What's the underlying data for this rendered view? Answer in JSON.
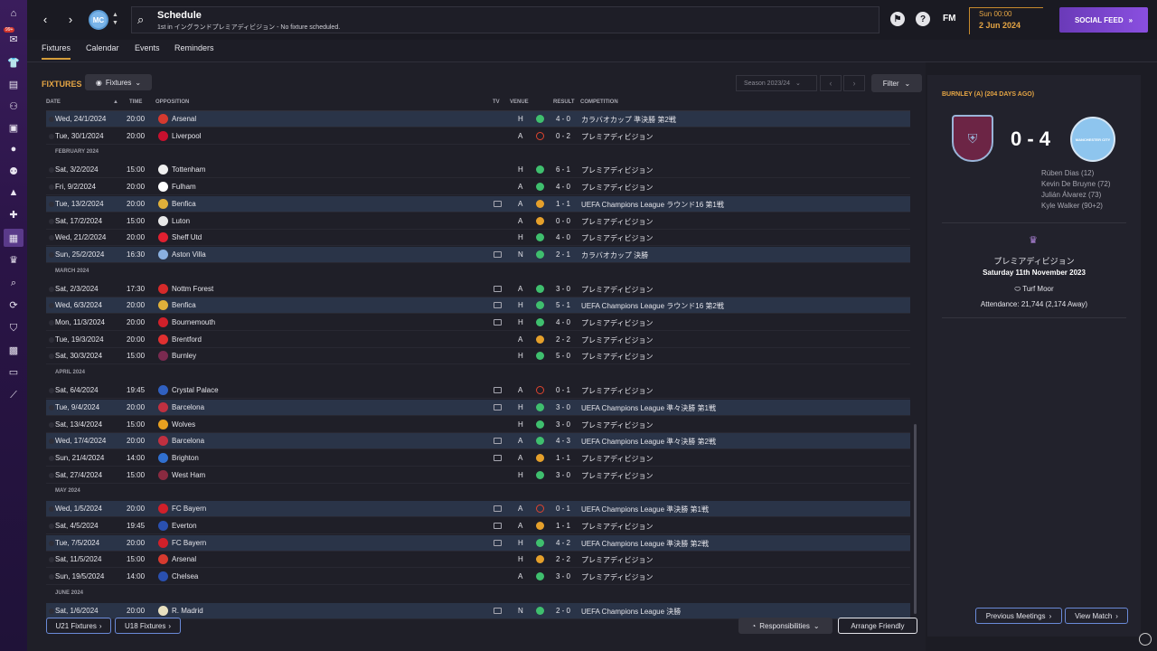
{
  "sidebar": {
    "badge": "99+",
    "icons": [
      "home-icon",
      "inbox-icon",
      "squad-icon",
      "tactics-icon",
      "staff-icon",
      "dynamics-icon",
      "medical-icon",
      "scouting-icon",
      "training-icon",
      "club-vision-icon",
      "schedule-icon",
      "competitions-icon",
      "data-hub-icon",
      "transfers-icon",
      "club-info-icon",
      "finances-icon",
      "dev-centre-icon",
      "report-icon"
    ]
  },
  "topbar": {
    "back": "‹",
    "forward": "›",
    "title": "Schedule",
    "subtitle": "1st in イングランドプレミアディビジョン - No fixture scheduled.",
    "help": "?",
    "fm": "FM",
    "time": "Sun 00:00",
    "date": "2 Jun 2024",
    "social_feed": "SOCIAL FEED"
  },
  "subtabs": [
    "Fixtures",
    "Calendar",
    "Events",
    "Reminders"
  ],
  "main": {
    "title": "FIXTURES",
    "dropdown": "Fixtures",
    "season": "Season 2023/24",
    "filter": "Filter",
    "headers": {
      "date": "DATE",
      "time": "TIME",
      "opposition": "OPPOSITION",
      "tv": "TV",
      "venue": "VENUE",
      "result": "RESULT",
      "competition": "COMPETITION"
    },
    "u21": "U21 Fixtures",
    "u18": "U18 Fixtures",
    "responsibilities": "Responsibilities",
    "arrange_friendly": "Arrange Friendly"
  },
  "fixtures": [
    {
      "date": "Wed, 24/1/2024",
      "time": "20:00",
      "opp": "Arsenal",
      "tv": false,
      "venue": "H",
      "outcome": "W",
      "score": "4 - 0",
      "comp": "カラバオカップ 準決勝 第2戦",
      "hl": true,
      "crest": "#d63a2f"
    },
    {
      "date": "Tue, 30/1/2024",
      "time": "20:00",
      "opp": "Liverpool",
      "tv": false,
      "venue": "A",
      "outcome": "L",
      "score": "0 - 2",
      "comp": "プレミアディビジョン",
      "hl": false,
      "crest": "#c8102e"
    },
    {
      "month": "FEBRUARY 2024"
    },
    {
      "date": "Sat, 3/2/2024",
      "time": "15:00",
      "opp": "Tottenham",
      "tv": false,
      "venue": "H",
      "outcome": "W",
      "score": "6 - 1",
      "comp": "プレミアディビジョン",
      "hl": false,
      "crest": "#f0f0f0"
    },
    {
      "date": "Fri, 9/2/2024",
      "time": "20:00",
      "opp": "Fulham",
      "tv": false,
      "venue": "A",
      "outcome": "W",
      "score": "4 - 0",
      "comp": "プレミアディビジョン",
      "hl": false,
      "crest": "#ffffff"
    },
    {
      "date": "Tue, 13/2/2024",
      "time": "20:00",
      "opp": "Benfica",
      "tv": true,
      "venue": "A",
      "outcome": "D",
      "score": "1 - 1",
      "comp": "UEFA Champions League ラウンド16 第1戦",
      "hl": true,
      "crest": "#e0b03a"
    },
    {
      "date": "Sat, 17/2/2024",
      "time": "15:00",
      "opp": "Luton",
      "tv": false,
      "venue": "A",
      "outcome": "D",
      "score": "0 - 0",
      "comp": "プレミアディビジョン",
      "hl": false,
      "crest": "#e8e8e8"
    },
    {
      "date": "Wed, 21/2/2024",
      "time": "20:00",
      "opp": "Sheff Utd",
      "tv": false,
      "venue": "H",
      "outcome": "W",
      "score": "4 - 0",
      "comp": "プレミアディビジョン",
      "hl": false,
      "crest": "#e02030"
    },
    {
      "date": "Sun, 25/2/2024",
      "time": "16:30",
      "opp": "Aston Villa",
      "tv": true,
      "venue": "N",
      "outcome": "W",
      "score": "2 - 1",
      "comp": "カラバオカップ 決勝",
      "hl": true,
      "crest": "#8ab0e0"
    },
    {
      "month": "MARCH 2024"
    },
    {
      "date": "Sat, 2/3/2024",
      "time": "17:30",
      "opp": "Nottm Forest",
      "tv": true,
      "venue": "A",
      "outcome": "W",
      "score": "3 - 0",
      "comp": "プレミアディビジョン",
      "hl": false,
      "crest": "#d62a2a"
    },
    {
      "date": "Wed, 6/3/2024",
      "time": "20:00",
      "opp": "Benfica",
      "tv": true,
      "venue": "H",
      "outcome": "W",
      "score": "5 - 1",
      "comp": "UEFA Champions League ラウンド16 第2戦",
      "hl": true,
      "crest": "#e0b03a"
    },
    {
      "date": "Mon, 11/3/2024",
      "time": "20:00",
      "opp": "Bournemouth",
      "tv": true,
      "venue": "H",
      "outcome": "W",
      "score": "4 - 0",
      "comp": "プレミアディビジョン",
      "hl": false,
      "crest": "#d0202a"
    },
    {
      "date": "Tue, 19/3/2024",
      "time": "20:00",
      "opp": "Brentford",
      "tv": false,
      "venue": "A",
      "outcome": "D",
      "score": "2 - 2",
      "comp": "プレミアディビジョン",
      "hl": false,
      "crest": "#e03030"
    },
    {
      "date": "Sat, 30/3/2024",
      "time": "15:00",
      "opp": "Burnley",
      "tv": false,
      "venue": "H",
      "outcome": "W",
      "score": "5 - 0",
      "comp": "プレミアディビジョン",
      "hl": false,
      "crest": "#7a2a50"
    },
    {
      "month": "APRIL 2024"
    },
    {
      "date": "Sat, 6/4/2024",
      "time": "19:45",
      "opp": "Crystal Palace",
      "tv": true,
      "venue": "A",
      "outcome": "L",
      "score": "0 - 1",
      "comp": "プレミアディビジョン",
      "hl": false,
      "crest": "#3060c0"
    },
    {
      "date": "Tue, 9/4/2024",
      "time": "20:00",
      "opp": "Barcelona",
      "tv": true,
      "venue": "H",
      "outcome": "W",
      "score": "3 - 0",
      "comp": "UEFA Champions League 準々決勝 第1戦",
      "hl": true,
      "crest": "#c03040"
    },
    {
      "date": "Sat, 13/4/2024",
      "time": "15:00",
      "opp": "Wolves",
      "tv": false,
      "venue": "H",
      "outcome": "W",
      "score": "3 - 0",
      "comp": "プレミアディビジョン",
      "hl": false,
      "crest": "#e8a020"
    },
    {
      "date": "Wed, 17/4/2024",
      "time": "20:00",
      "opp": "Barcelona",
      "tv": true,
      "venue": "A",
      "outcome": "W",
      "score": "4 - 3",
      "comp": "UEFA Champions League 準々決勝 第2戦",
      "hl": true,
      "crest": "#c03040"
    },
    {
      "date": "Sun, 21/4/2024",
      "time": "14:00",
      "opp": "Brighton",
      "tv": true,
      "venue": "A",
      "outcome": "D",
      "score": "1 - 1",
      "comp": "プレミアディビジョン",
      "hl": false,
      "crest": "#3070d0"
    },
    {
      "date": "Sat, 27/4/2024",
      "time": "15:00",
      "opp": "West Ham",
      "tv": false,
      "venue": "H",
      "outcome": "W",
      "score": "3 - 0",
      "comp": "プレミアディビジョン",
      "hl": false,
      "crest": "#8a2a40"
    },
    {
      "month": "MAY 2024"
    },
    {
      "date": "Wed, 1/5/2024",
      "time": "20:00",
      "opp": "FC Bayern",
      "tv": true,
      "venue": "A",
      "outcome": "L",
      "score": "0 - 1",
      "comp": "UEFA Champions League 準決勝 第1戦",
      "hl": true,
      "crest": "#d0202a"
    },
    {
      "date": "Sat, 4/5/2024",
      "time": "19:45",
      "opp": "Everton",
      "tv": true,
      "venue": "A",
      "outcome": "D",
      "score": "1 - 1",
      "comp": "プレミアディビジョン",
      "hl": false,
      "crest": "#2a50b0"
    },
    {
      "date": "Tue, 7/5/2024",
      "time": "20:00",
      "opp": "FC Bayern",
      "tv": true,
      "venue": "H",
      "outcome": "W",
      "score": "4 - 2",
      "comp": "UEFA Champions League 準決勝 第2戦",
      "hl": true,
      "crest": "#d0202a"
    },
    {
      "date": "Sat, 11/5/2024",
      "time": "15:00",
      "opp": "Arsenal",
      "tv": false,
      "venue": "H",
      "outcome": "D",
      "score": "2 - 2",
      "comp": "プレミアディビジョン",
      "hl": false,
      "crest": "#d63a2f"
    },
    {
      "date": "Sun, 19/5/2024",
      "time": "14:00",
      "opp": "Chelsea",
      "tv": false,
      "venue": "A",
      "outcome": "W",
      "score": "3 - 0",
      "comp": "プレミアディビジョン",
      "hl": false,
      "crest": "#2a50b0"
    },
    {
      "month": "JUNE 2024"
    },
    {
      "date": "Sat, 1/6/2024",
      "time": "20:00",
      "opp": "R. Madrid",
      "tv": true,
      "venue": "N",
      "outcome": "W",
      "score": "2 - 0",
      "comp": "UEFA Champions League 決勝",
      "hl": true,
      "crest": "#e8e0c0"
    }
  ],
  "detail": {
    "title": "BURNLEY (A) (204 DAYS AGO)",
    "score": "0 - 4",
    "away_crest_text": "MANCHESTER CITY",
    "scorers": [
      "Rúben Dias (12)",
      "Kevin De Bruyne (72)",
      "Julián Álvarez (73)",
      "Kyle Walker (90+2)"
    ],
    "competition": "プレミアディビジョン",
    "match_date": "Saturday 11th November 2023",
    "stadium": "Turf Moor",
    "attendance": "Attendance: 21,744 (2,174 Away)",
    "previous_meetings": "Previous Meetings",
    "view_match": "View Match"
  }
}
